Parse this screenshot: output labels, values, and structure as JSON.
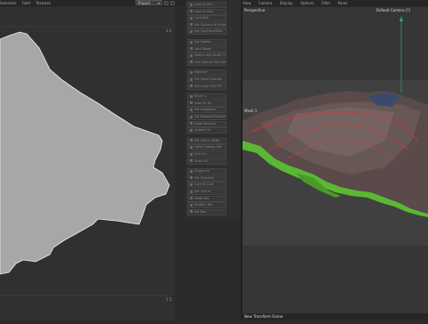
{
  "left_panel": {
    "menu": [
      "Selection",
      "Field",
      "Textures"
    ],
    "dropdown_value": "Project",
    "axis_top": "1.5",
    "axis_bottom": "1.5"
  },
  "toolbox": {
    "items": [
      "Look At Pos",
      "Look At Ray",
      "Lock Ball",
      "Set Camera to Projection",
      "Set Top/Front/Side",
      "Set Mobile",
      "Lock Mode",
      "Sketch and Scroll Clamping",
      "Line Texture Set Blending",
      "Material",
      "Set View Controls",
      "Set Layer Pull Off",
      "Brush 1",
      "Look At 1D",
      "Set Neighbors",
      "Set Masked Position",
      "Edge Pointers",
      "Spawn Lin",
      "Set Select Mode",
      "Select Sweep Set",
      "Link Lin",
      "Scale All",
      "Single Lin",
      "Set Sinkable",
      "Lock at Lock",
      "Set Lin/Lin",
      "Dead Set",
      "Position Set",
      "Set Box"
    ],
    "top_icons": [
      "Look At Pos",
      "Look At Ray",
      "Lock Ball"
    ]
  },
  "right_panel": {
    "menu": [
      "View",
      "Camera",
      "Display",
      "Options",
      "Filter",
      "Panel"
    ],
    "viewport_mode": "Perspective",
    "camera_label": "Default Camera (?)",
    "model_label": "Mesh 1",
    "status": "New Transform Scene"
  },
  "colors": {
    "terrain_side": "#5bb833",
    "axis_y": "#2aa877",
    "map_fill": "#a7a7a7"
  }
}
